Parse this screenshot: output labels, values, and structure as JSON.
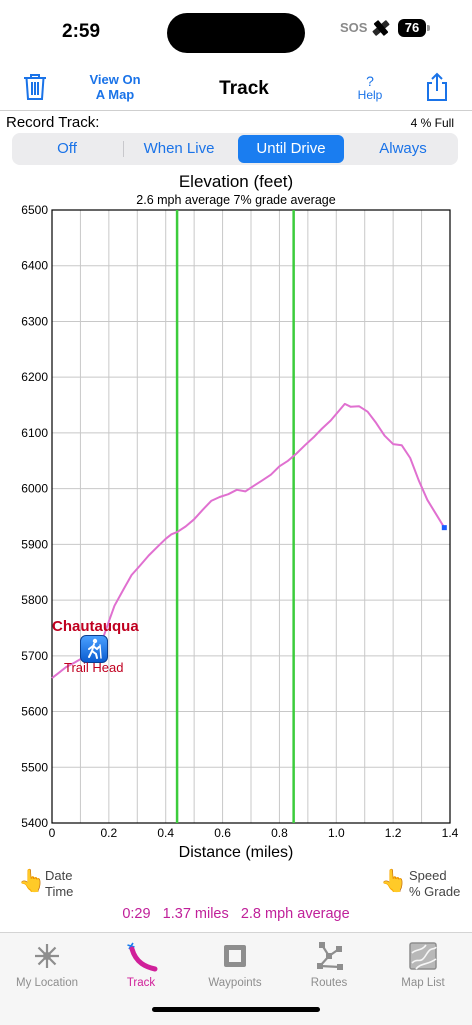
{
  "status": {
    "time": "2:59",
    "sos": "SOS",
    "battery": "76"
  },
  "nav": {
    "title": "Track",
    "view_map_line1": "View On",
    "view_map_line2": "A Map",
    "help_mark": "?",
    "help_label": "Help"
  },
  "record": {
    "label": "Record Track:",
    "storage": "4 % Full",
    "options": [
      "Off",
      "When Live",
      "Until Drive",
      "Always"
    ],
    "selected": "Until Drive"
  },
  "chart_data": {
    "type": "line",
    "title": "Elevation (feet)",
    "subtitle": "2.6 mph average  7% grade average",
    "xlabel": "Distance (miles)",
    "ylabel": "",
    "xlim": [
      0,
      1.4
    ],
    "ylim": [
      5400,
      6500
    ],
    "xticks": [
      "0",
      "0.2",
      "0.4",
      "0.6",
      "0.8",
      "1.0",
      "1.2",
      "1.4"
    ],
    "yticks": [
      "5400",
      "5500",
      "5600",
      "5700",
      "5800",
      "5900",
      "6000",
      "6100",
      "6200",
      "6300",
      "6400",
      "6500"
    ],
    "grid": true,
    "line_color": "#e070d0",
    "marker_lines": [
      0.44,
      0.85
    ],
    "marker_color": "#3ccc3c",
    "series": [
      {
        "x": [
          0,
          0.02,
          0.05,
          0.08,
          0.11,
          0.14,
          0.17,
          0.2,
          0.22,
          0.25,
          0.28,
          0.31,
          0.34,
          0.37,
          0.4,
          0.42,
          0.44,
          0.47,
          0.5,
          0.53,
          0.56,
          0.59,
          0.62,
          0.65,
          0.68,
          0.71,
          0.74,
          0.77,
          0.8,
          0.83,
          0.86,
          0.89,
          0.92,
          0.95,
          0.98,
          1.01,
          1.03,
          1.05,
          1.08,
          1.11,
          1.14,
          1.17,
          1.2,
          1.23,
          1.26,
          1.29,
          1.32,
          1.35,
          1.38
        ],
        "y": [
          5660,
          5668,
          5680,
          5688,
          5697,
          5705,
          5718,
          5762,
          5790,
          5818,
          5845,
          5862,
          5880,
          5895,
          5910,
          5918,
          5922,
          5932,
          5945,
          5962,
          5978,
          5985,
          5990,
          5998,
          5995,
          6005,
          6015,
          6025,
          6040,
          6050,
          6063,
          6078,
          6092,
          6108,
          6122,
          6140,
          6152,
          6147,
          6148,
          6138,
          6118,
          6095,
          6080,
          6078,
          6055,
          6015,
          5980,
          5955,
          5930
        ]
      }
    ],
    "end_point": {
      "x": 1.38,
      "y": 5930
    },
    "waypoint": {
      "x": 0.14,
      "y": 5705,
      "name": "Chautauqua",
      "label": "Trail Head"
    }
  },
  "legend": {
    "left_line1": "Date",
    "left_line2": "Time",
    "right_line1": "Speed",
    "right_line2": "% Grade"
  },
  "summary": {
    "duration": "0:29",
    "distance": "1.37 miles",
    "speed": "2.8 mph average"
  },
  "tabs": [
    "My Location",
    "Track",
    "Waypoints",
    "Routes",
    "Map List"
  ],
  "active_tab": "Track"
}
